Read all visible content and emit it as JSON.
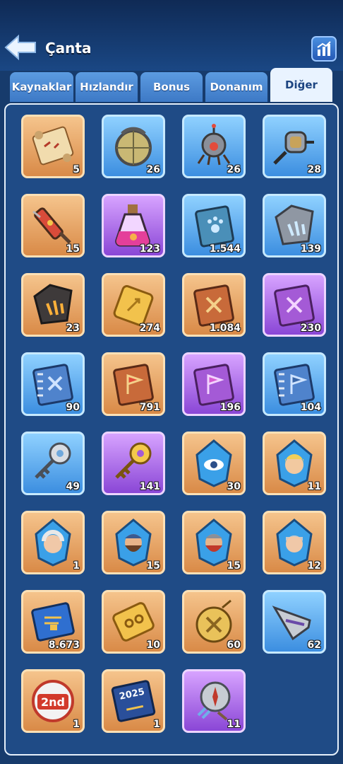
{
  "header": {
    "title": "Çanta",
    "back_icon": "back-arrow-icon",
    "stats_icon": "bar-chart-icon"
  },
  "tabs": [
    {
      "label": "Kaynaklar",
      "active": false
    },
    {
      "label": "Hızlandır",
      "active": false
    },
    {
      "label": "Bonus",
      "active": false
    },
    {
      "label": "Donanım",
      "active": false
    },
    {
      "label": "Diğer",
      "active": true
    }
  ],
  "items": [
    {
      "name": "treasure-map",
      "count": "5",
      "rarity": "orange"
    },
    {
      "name": "metal-sphere",
      "count": "26",
      "rarity": "blue"
    },
    {
      "name": "robot-drone",
      "count": "26",
      "rarity": "blue"
    },
    {
      "name": "fishing-reel",
      "count": "28",
      "rarity": "blue"
    },
    {
      "name": "syringe",
      "count": "15",
      "rarity": "orange"
    },
    {
      "name": "potion-flask",
      "count": "123",
      "rarity": "purple"
    },
    {
      "name": "paw-book",
      "count": "1.544",
      "rarity": "blue"
    },
    {
      "name": "blue-crystal-stone",
      "count": "139",
      "rarity": "blue"
    },
    {
      "name": "fire-crystal-stone",
      "count": "23",
      "rarity": "orange"
    },
    {
      "name": "golden-ticket",
      "count": "274",
      "rarity": "orange"
    },
    {
      "name": "orange-sword-book",
      "count": "1.084",
      "rarity": "orange"
    },
    {
      "name": "purple-sword-book",
      "count": "230",
      "rarity": "purple"
    },
    {
      "name": "blue-spiral-sword-book",
      "count": "90",
      "rarity": "blue"
    },
    {
      "name": "orange-flag-book",
      "count": "791",
      "rarity": "orange"
    },
    {
      "name": "purple-flag-book",
      "count": "196",
      "rarity": "purple"
    },
    {
      "name": "blue-spiral-flag-book",
      "count": "104",
      "rarity": "blue"
    },
    {
      "name": "silver-key",
      "count": "49",
      "rarity": "blue"
    },
    {
      "name": "gold-key",
      "count": "141",
      "rarity": "purple"
    },
    {
      "name": "eye-crystal",
      "count": "30",
      "rarity": "orange"
    },
    {
      "name": "hero-crystal-blonde",
      "count": "11",
      "rarity": "orange"
    },
    {
      "name": "hero-crystal-elder",
      "count": "1",
      "rarity": "orange"
    },
    {
      "name": "hero-crystal-bearded",
      "count": "15",
      "rarity": "orange"
    },
    {
      "name": "hero-crystal-redbeard",
      "count": "15",
      "rarity": "orange"
    },
    {
      "name": "hero-crystal-knight",
      "count": "12",
      "rarity": "orange"
    },
    {
      "name": "blue-skill-book",
      "count": "8.673",
      "rarity": "orange"
    },
    {
      "name": "golden-coupon",
      "count": "10",
      "rarity": "orange"
    },
    {
      "name": "gold-medal",
      "count": "60",
      "rarity": "orange"
    },
    {
      "name": "arrow-head",
      "count": "62",
      "rarity": "blue"
    },
    {
      "name": "second-place-badge",
      "count": "1",
      "rarity": "orange"
    },
    {
      "name": "calendar-book-2025",
      "count": "1",
      "rarity": "orange"
    },
    {
      "name": "compass-pocket",
      "count": "11",
      "rarity": "purple"
    }
  ],
  "badge_texts": {
    "second_place": "2nd",
    "year": "2025"
  },
  "colors": {
    "background": "#173b6c",
    "panel": "#1f4b86",
    "tab_active": "#e9f3ff",
    "tab_inactive": "#4b8bd6",
    "rarity_orange": "#e8a45f",
    "rarity_blue": "#5aaef0",
    "rarity_purple": "#a764e8"
  }
}
